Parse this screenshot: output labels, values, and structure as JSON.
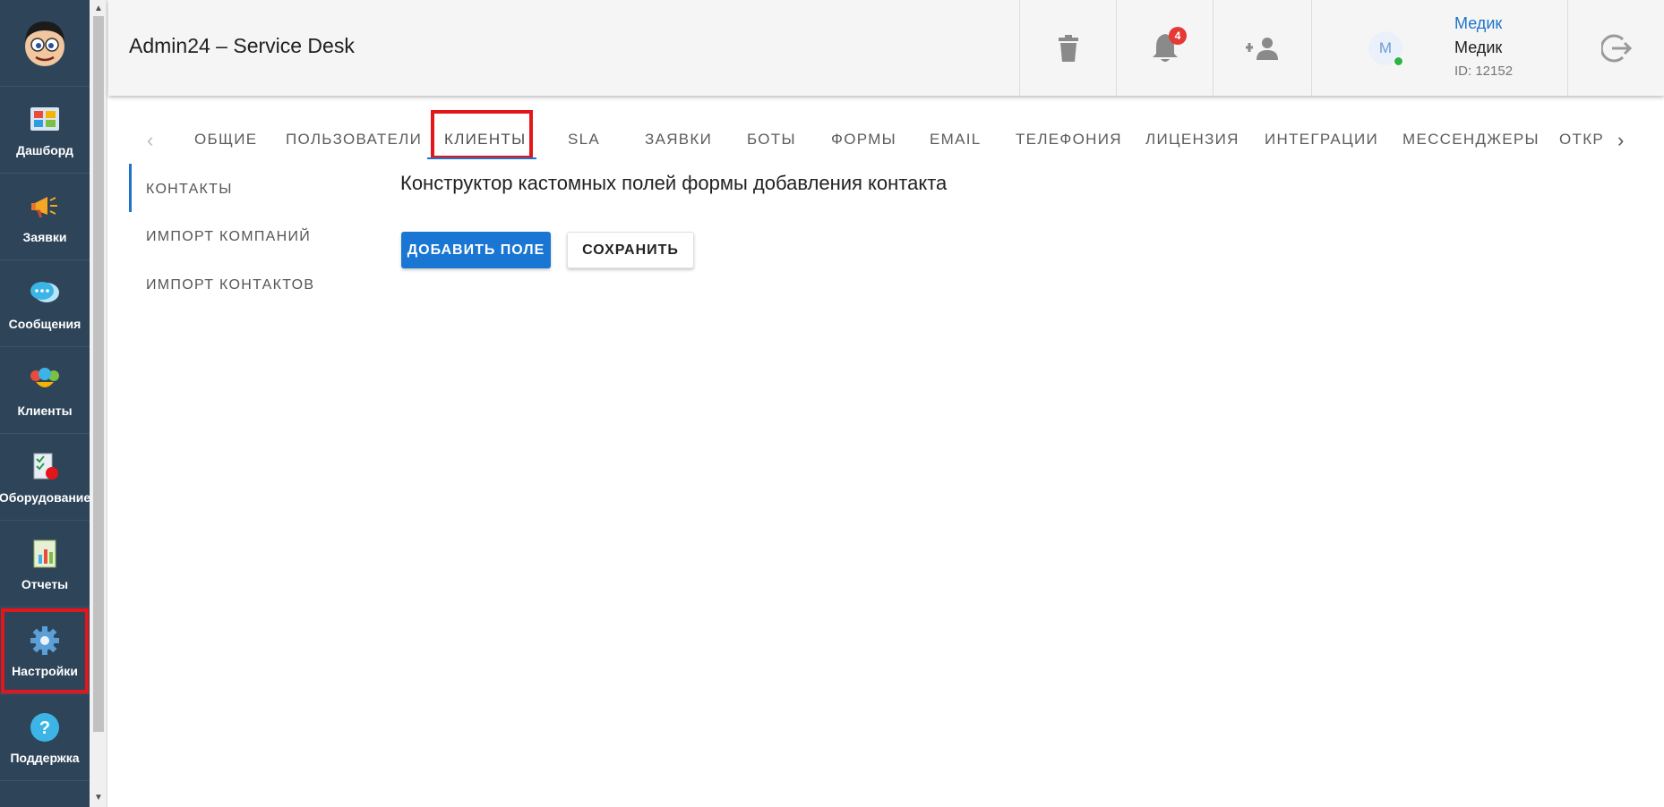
{
  "header": {
    "app_title": "Admin24 – Service Desk",
    "notification_count": "4",
    "user": {
      "link_name": "Медик",
      "name": "Медик",
      "id_text": "ID: 12152",
      "avatar_initial": "M"
    }
  },
  "sidebar": {
    "items": [
      {
        "label": "Дашборд",
        "icon": "dashboard-icon"
      },
      {
        "label": "Заявки",
        "icon": "megaphone-icon"
      },
      {
        "label": "Сообщения",
        "icon": "chat-bubbles-icon"
      },
      {
        "label": "Клиенты",
        "icon": "clients-icon"
      },
      {
        "label": "Оборудование",
        "icon": "equipment-icon"
      },
      {
        "label": "Отчеты",
        "icon": "reports-icon"
      },
      {
        "label": "Настройки",
        "icon": "gear-icon"
      },
      {
        "label": "Поддержка",
        "icon": "help-icon"
      }
    ]
  },
  "tabs": [
    "ОБЩИЕ",
    "ПОЛЬЗОВАТЕЛИ",
    "КЛИЕНТЫ",
    "SLA",
    "ЗАЯВКИ",
    "БОТЫ",
    "ФОРМЫ",
    "EMAIL",
    "ТЕЛЕФОНИЯ",
    "ЛИЦЕНЗИЯ",
    "ИНТЕГРАЦИИ",
    "МЕССЕНДЖЕРЫ",
    "ОТКР"
  ],
  "subnav": [
    "КОНТАКТЫ",
    "ИМПОРТ КОМПАНИЙ",
    "ИМПОРТ КОНТАКТОВ"
  ],
  "main": {
    "title": "Конструктор кастомных полей формы добавления контакта",
    "add_button": "ДОБАВИТЬ ПОЛЕ",
    "save_button": "СОХРАНИТЬ"
  },
  "colors": {
    "sidebar_bg": "#2e4459",
    "accent": "#1976d2",
    "highlight": "#e3161b"
  }
}
